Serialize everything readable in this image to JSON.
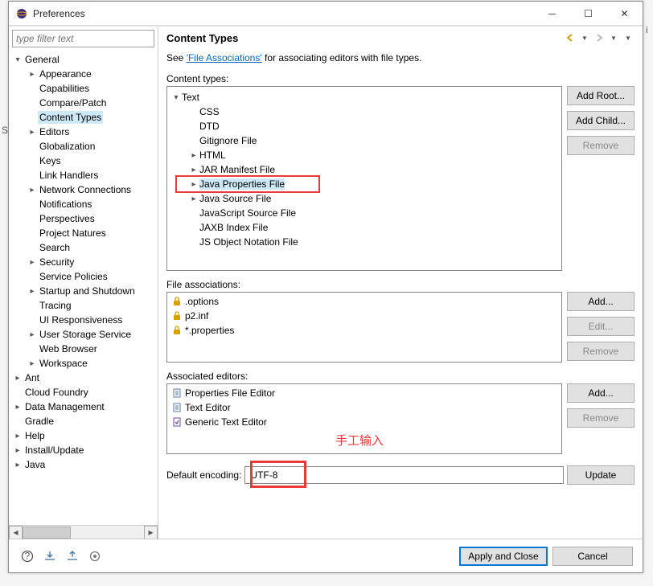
{
  "window": {
    "title": "Preferences"
  },
  "sidebar": {
    "filter_placeholder": "type filter text",
    "items": [
      {
        "label": "General",
        "depth": 0,
        "arrow": "▾"
      },
      {
        "label": "Appearance",
        "depth": 1,
        "arrow": "▸"
      },
      {
        "label": "Capabilities",
        "depth": 1,
        "arrow": ""
      },
      {
        "label": "Compare/Patch",
        "depth": 1,
        "arrow": ""
      },
      {
        "label": "Content Types",
        "depth": 1,
        "arrow": "",
        "selected": true
      },
      {
        "label": "Editors",
        "depth": 1,
        "arrow": "▸"
      },
      {
        "label": "Globalization",
        "depth": 1,
        "arrow": ""
      },
      {
        "label": "Keys",
        "depth": 1,
        "arrow": ""
      },
      {
        "label": "Link Handlers",
        "depth": 1,
        "arrow": ""
      },
      {
        "label": "Network Connections",
        "depth": 1,
        "arrow": "▸"
      },
      {
        "label": "Notifications",
        "depth": 1,
        "arrow": ""
      },
      {
        "label": "Perspectives",
        "depth": 1,
        "arrow": ""
      },
      {
        "label": "Project Natures",
        "depth": 1,
        "arrow": ""
      },
      {
        "label": "Search",
        "depth": 1,
        "arrow": ""
      },
      {
        "label": "Security",
        "depth": 1,
        "arrow": "▸"
      },
      {
        "label": "Service Policies",
        "depth": 1,
        "arrow": ""
      },
      {
        "label": "Startup and Shutdown",
        "depth": 1,
        "arrow": "▸"
      },
      {
        "label": "Tracing",
        "depth": 1,
        "arrow": ""
      },
      {
        "label": "UI Responsiveness",
        "depth": 1,
        "arrow": ""
      },
      {
        "label": "User Storage Service",
        "depth": 1,
        "arrow": "▸"
      },
      {
        "label": "Web Browser",
        "depth": 1,
        "arrow": ""
      },
      {
        "label": "Workspace",
        "depth": 1,
        "arrow": "▸"
      },
      {
        "label": "Ant",
        "depth": 0,
        "arrow": "▸"
      },
      {
        "label": "Cloud Foundry",
        "depth": 0,
        "arrow": ""
      },
      {
        "label": "Data Management",
        "depth": 0,
        "arrow": "▸"
      },
      {
        "label": "Gradle",
        "depth": 0,
        "arrow": ""
      },
      {
        "label": "Help",
        "depth": 0,
        "arrow": "▸"
      },
      {
        "label": "Install/Update",
        "depth": 0,
        "arrow": "▸"
      },
      {
        "label": "Java",
        "depth": 0,
        "arrow": "▸"
      }
    ]
  },
  "main": {
    "heading": "Content Types",
    "desc_prefix": "See ",
    "desc_link": "'File Associations'",
    "desc_suffix": " for associating editors with file types.",
    "content_types_label": "Content types:",
    "content_types": [
      {
        "label": "Text",
        "depth": 0,
        "arrow": "▾"
      },
      {
        "label": "CSS",
        "depth": 1,
        "arrow": ""
      },
      {
        "label": "DTD",
        "depth": 1,
        "arrow": ""
      },
      {
        "label": "Gitignore File",
        "depth": 1,
        "arrow": ""
      },
      {
        "label": "HTML",
        "depth": 1,
        "arrow": "▸"
      },
      {
        "label": "JAR Manifest File",
        "depth": 1,
        "arrow": "▸"
      },
      {
        "label": "Java Properties File",
        "depth": 1,
        "arrow": "▸",
        "selected": true,
        "highlighted": true
      },
      {
        "label": "Java Source File",
        "depth": 1,
        "arrow": "▸"
      },
      {
        "label": "JavaScript Source File",
        "depth": 1,
        "arrow": ""
      },
      {
        "label": "JAXB Index File",
        "depth": 1,
        "arrow": ""
      },
      {
        "label": "JS Object Notation File",
        "depth": 1,
        "arrow": ""
      }
    ],
    "ct_buttons": {
      "add_root": "Add Root...",
      "add_child": "Add Child...",
      "remove": "Remove"
    },
    "file_assoc_label": "File associations:",
    "file_assoc": [
      ".options",
      "p2.inf",
      "*.properties"
    ],
    "fa_buttons": {
      "add": "Add...",
      "edit": "Edit...",
      "remove": "Remove"
    },
    "editors_label": "Associated editors:",
    "editors": [
      "Properties File Editor",
      "Text Editor",
      "Generic Text Editor"
    ],
    "ed_buttons": {
      "add": "Add...",
      "remove": "Remove"
    },
    "encoding_label": "Default encoding:",
    "encoding_value": "UTF-8",
    "update_btn": "Update",
    "annotation": "手工输入"
  },
  "footer": {
    "apply": "Apply and Close",
    "cancel": "Cancel"
  }
}
